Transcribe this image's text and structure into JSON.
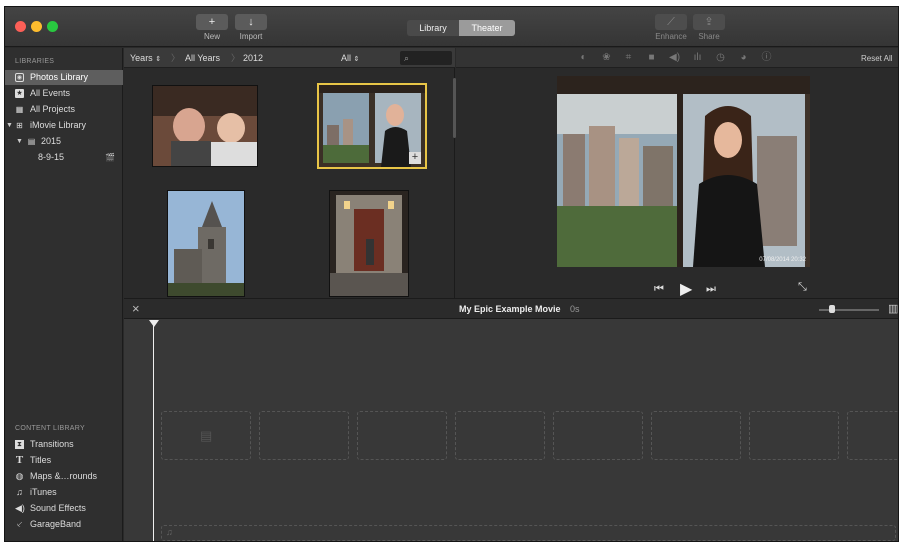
{
  "toolbar": {
    "new_label": "New",
    "new_glyph": "+",
    "import_label": "Import",
    "import_glyph": "↓",
    "library_tab": "Library",
    "theater_tab": "Theater",
    "enhance_label": "Enhance",
    "share_label": "Share"
  },
  "sidebar": {
    "libraries_title": "LIBRARIES",
    "items": [
      {
        "label": "Photos Library",
        "icon": "photos-icon",
        "selected": true
      },
      {
        "label": "All Events",
        "icon": "star-icon"
      },
      {
        "label": "All Projects",
        "icon": "projects-grid-icon"
      },
      {
        "label": "iMovie Library",
        "icon": "library-grid-icon"
      },
      {
        "label": "2015",
        "icon": "calendar-icon"
      },
      {
        "label": "8-9-15",
        "icon": "clapper-icon"
      }
    ],
    "content_title": "CONTENT LIBRARY",
    "content_items": [
      {
        "label": "Transitions",
        "icon": "transitions-icon"
      },
      {
        "label": "Titles",
        "icon": "titles-icon",
        "glyph": "T"
      },
      {
        "label": "Maps &…rounds",
        "icon": "globe-icon"
      },
      {
        "label": "iTunes",
        "icon": "music-note-icon",
        "glyph": "♫"
      },
      {
        "label": "Sound Effects",
        "icon": "speaker-icon"
      },
      {
        "label": "GarageBand",
        "icon": "guitar-icon"
      }
    ]
  },
  "browser": {
    "crumb_years": "Years",
    "crumb_all_years": "All Years",
    "crumb_2012": "2012",
    "filter": "All"
  },
  "viewer": {
    "timestamp": "07/08/2014 20:32",
    "reset_all": "Reset All"
  },
  "timeline": {
    "project_title": "My Epic Example Movie",
    "duration": "0s"
  },
  "colors": {
    "selection": "#e8c547",
    "selected_sidebar_bg": "#5e5e5e",
    "theater_tab_bg": "#9b9b9b"
  }
}
